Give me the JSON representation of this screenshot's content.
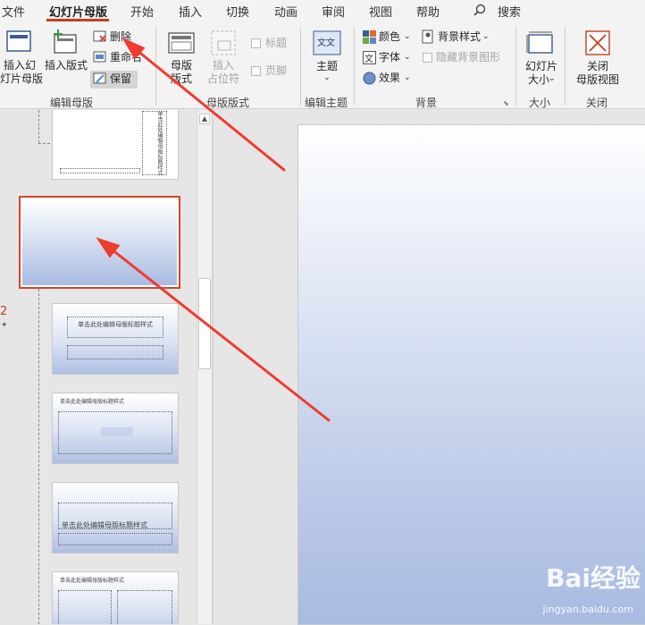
{
  "tabs": [
    "文件",
    "幻灯片母版",
    "开始",
    "插入",
    "切换",
    "动画",
    "审阅",
    "视图",
    "帮助"
  ],
  "search_label": "搜索",
  "ribbon": {
    "insert_master": [
      "插入幻",
      "灯片母版"
    ],
    "insert_layout": "插入版式",
    "delete": "删除",
    "rename": "重命名",
    "preserve": "保留",
    "master_layout": [
      "母版",
      "版式"
    ],
    "insert_placeholder": [
      "插入",
      "占位符"
    ],
    "title_chk": "标题",
    "footer_chk": "页脚",
    "theme": "主题",
    "colors": "颜色",
    "fonts": "字体",
    "effects": "效果",
    "bg_styles": "背景样式",
    "hide_bg": "隐藏背景图形",
    "slide_size": [
      "幻灯片",
      "大小"
    ],
    "close_master": [
      "关闭",
      "母版视图"
    ],
    "groups": {
      "edit_master": "编辑母版",
      "master_layout": "母版版式",
      "edit_theme": "编辑主题",
      "background": "背景",
      "size": "大小",
      "close": "关闭"
    }
  },
  "slide_number": "2",
  "thumbnails": {
    "top_vertical": "单击此处编辑母版标题样式",
    "layout1_title": "单击此处编辑母版标题样式",
    "layout2_title": "单击此处编辑母版标题样式",
    "layout3_title": "单击此处编辑母版标题样式",
    "layout4_title": "单击此处编辑母版标题样式"
  },
  "watermark": {
    "brand": "Bai经验",
    "url": "jingyan.baidu.com"
  },
  "colors": {
    "accent": "#c43e1c",
    "arrow": "#f03c2e",
    "selection": "#d24726"
  }
}
